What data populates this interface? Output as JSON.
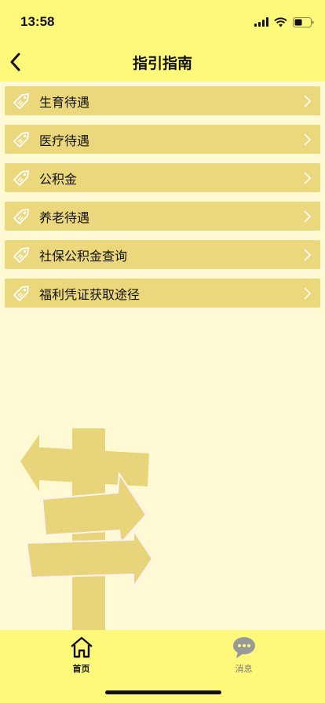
{
  "status_bar": {
    "time": "13:58"
  },
  "header": {
    "title": "指引指南"
  },
  "menu": {
    "items": [
      {
        "label": "生育待遇"
      },
      {
        "label": "医疗待遇"
      },
      {
        "label": "公积金"
      },
      {
        "label": "养老待遇"
      },
      {
        "label": "社保公积金查询"
      },
      {
        "label": "福利凭证获取途径"
      }
    ]
  },
  "tabbar": {
    "tabs": [
      {
        "label": "首页",
        "icon": "home-icon",
        "active": true
      },
      {
        "label": "消息",
        "icon": "chat-bubble-icon",
        "active": false
      }
    ]
  },
  "colors": {
    "header_bg": "#FEF97A",
    "page_bg": "#FFF9D4",
    "item_bg": "#EBD87D",
    "signpost": "#E8D47A"
  }
}
